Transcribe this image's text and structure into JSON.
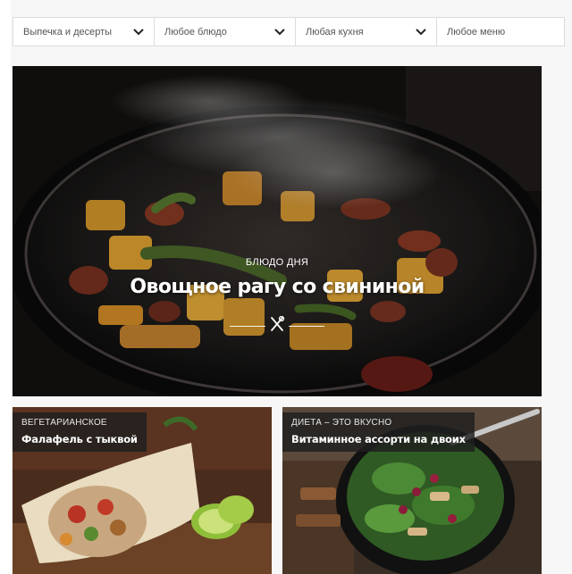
{
  "filters": [
    {
      "label": "Выпечка и десерты",
      "icon": "chevron-down-icon"
    },
    {
      "label": "Любое блюдо",
      "icon": "chevron-down-icon"
    },
    {
      "label": "Любая кухня",
      "icon": "chevron-down-icon"
    },
    {
      "label": "Любое меню",
      "icon": "chevron-down-icon"
    }
  ],
  "hero": {
    "kicker": "БЛЮДО ДНЯ",
    "title": "Овощное рагу со свининой",
    "icon": "fork-knife-icon"
  },
  "cards": [
    {
      "kicker": "ВЕГЕТАРИАНСКОЕ",
      "title": "Фалафель с тыквой"
    },
    {
      "kicker": "ДИЕТА – ЭТО ВКУСНО",
      "title": "Витаминное ассорти на двоих"
    }
  ],
  "colors": {
    "filter_border": "#dcdcdc",
    "label_bg": "#1e1e1e",
    "text_light": "#ffffff"
  }
}
